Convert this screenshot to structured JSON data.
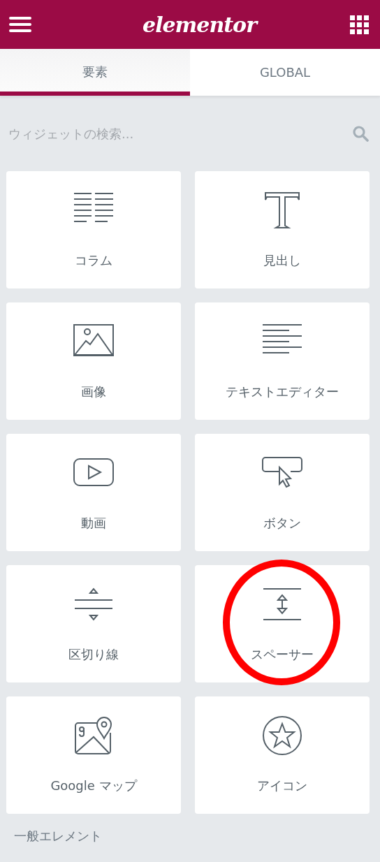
{
  "header": {
    "logo": "elementor"
  },
  "tabs": [
    {
      "label": "要素",
      "selected": true
    },
    {
      "label": "GLOBAL",
      "selected": false
    }
  ],
  "search": {
    "placeholder": "ウィジェットの検索..."
  },
  "widgets": [
    {
      "label": "コラム",
      "kind": "columns",
      "highlighted": false
    },
    {
      "label": "見出し",
      "kind": "heading",
      "highlighted": false
    },
    {
      "label": "画像",
      "kind": "image",
      "highlighted": false
    },
    {
      "label": "テキストエディター",
      "kind": "text",
      "highlighted": false
    },
    {
      "label": "動画",
      "kind": "video",
      "highlighted": false
    },
    {
      "label": "ボタン",
      "kind": "button",
      "highlighted": false
    },
    {
      "label": "区切り線",
      "kind": "divider",
      "highlighted": false
    },
    {
      "label": "スペーサー",
      "kind": "spacer",
      "highlighted": true
    },
    {
      "label": "Google マップ",
      "kind": "map",
      "highlighted": false
    },
    {
      "label": "アイコン",
      "kind": "star",
      "highlighted": false
    }
  ],
  "section_title": "一般エレメント"
}
